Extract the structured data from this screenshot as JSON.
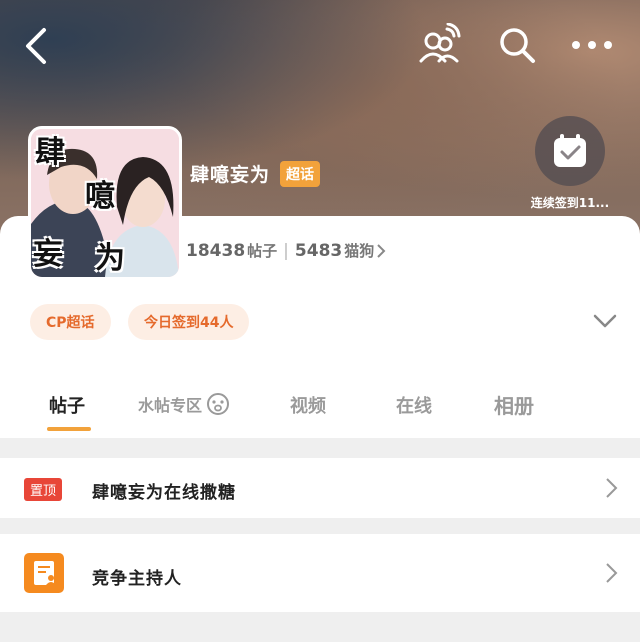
{
  "header": {
    "back_icon": "chevron-left-icon",
    "people_icon": "people-wifi-icon",
    "search_icon": "search-icon",
    "more_icon": "more-dots-icon"
  },
  "profile": {
    "avatar_chars": [
      "肆",
      "噫",
      "妄",
      "为"
    ],
    "title": "肆噫妄为",
    "badge": "超话",
    "checkin_label": "连续签到11..."
  },
  "stats": {
    "posts_count": "18438",
    "posts_label": "帖子",
    "fans_count": "5483",
    "fans_label": "猫狗"
  },
  "pills": {
    "cp": "CP超话",
    "today": "今日签到44人"
  },
  "tabs": [
    {
      "label": "帖子"
    },
    {
      "label": "水帖专区"
    },
    {
      "label": "视频"
    },
    {
      "label": "在线"
    },
    {
      "label": "相册"
    }
  ],
  "rows": {
    "pinned_badge": "置顶",
    "pinned_text": "肆噫妄为在线撒糖",
    "contest_text": "竞争主持人"
  },
  "colors": {
    "accent": "#f2a23b",
    "pill_text": "#e56a2c",
    "pin_red": "#e84638",
    "doc_orange": "#f58a1f"
  }
}
